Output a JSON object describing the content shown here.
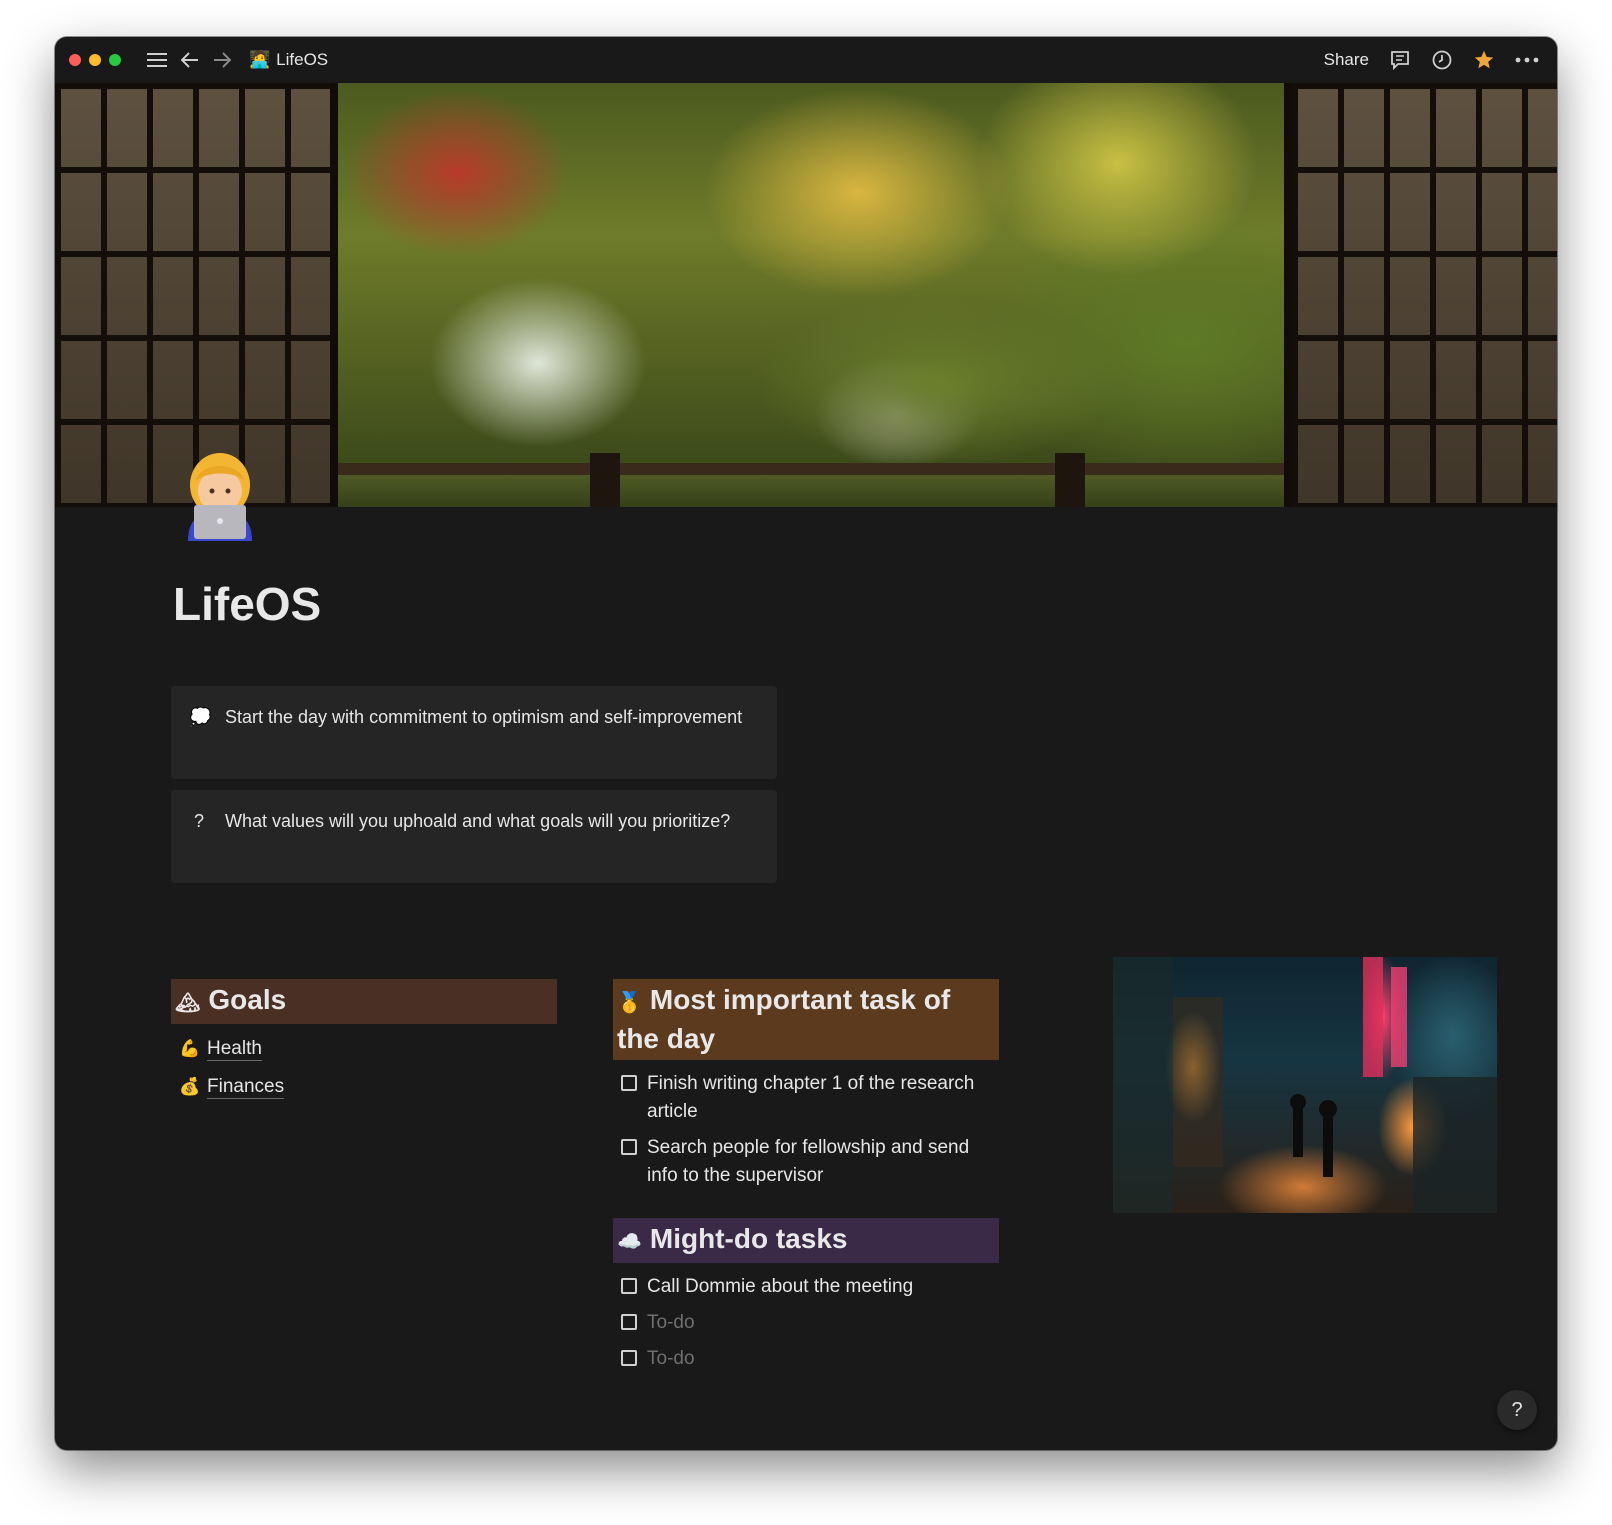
{
  "window": {
    "title": "LifeOS",
    "breadcrumb_emoji": "🧑‍💻",
    "share_label": "Share"
  },
  "page": {
    "title": "LifeOS",
    "avatar_emoji": "👩‍💻"
  },
  "callouts": [
    {
      "icon": "💭",
      "text": "Start the day with commitment to optimism and self-improvement"
    },
    {
      "icon": "?",
      "text": "What values will you uphoald and what goals will you prioritize?"
    }
  ],
  "goals": {
    "heading_icon": "🏔",
    "heading": "Goals",
    "items": [
      {
        "icon": "💪",
        "label": "Health"
      },
      {
        "icon": "💰",
        "label": "Finances"
      }
    ]
  },
  "mit": {
    "heading_icon": "🥇",
    "heading": "Most important task of the day",
    "todos": [
      {
        "text": "Finish writing chapter 1 of the research article",
        "placeholder": false
      },
      {
        "text": "Search people for fellowship and send info to the supervisor",
        "placeholder": false
      }
    ]
  },
  "might_do": {
    "heading_icon": "☁️",
    "heading": "Might-do tasks",
    "todos": [
      {
        "text": "Call Dommie about the meeting",
        "placeholder": false
      },
      {
        "text": "To-do",
        "placeholder": true
      },
      {
        "text": "To-do",
        "placeholder": true
      }
    ]
  },
  "help_label": "?",
  "colors": {
    "background": "#191919",
    "callout_bg": "#252525",
    "goals_heading_bg": "#4a2f24",
    "mit_heading_bg": "#5c3a1e",
    "might_do_heading_bg": "#3b2a47",
    "favorite_star": "#f0a53a"
  }
}
